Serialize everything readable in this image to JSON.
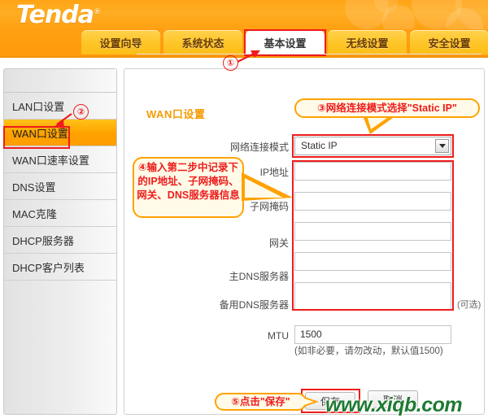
{
  "header": {
    "brand": "Tenda",
    "registered_mark": "®"
  },
  "tabs": [
    {
      "label": "设置向导",
      "active": false
    },
    {
      "label": "系统状态",
      "active": false
    },
    {
      "label": "基本设置",
      "active": true
    },
    {
      "label": "无线设置",
      "active": false
    },
    {
      "label": "安全设置",
      "active": false
    }
  ],
  "sidebar": {
    "items": [
      {
        "label": "LAN口设置",
        "active": false
      },
      {
        "label": "WAN口设置",
        "active": true
      },
      {
        "label": "WAN口速率设置",
        "active": false
      },
      {
        "label": "DNS设置",
        "active": false
      },
      {
        "label": "MAC克隆",
        "active": false
      },
      {
        "label": "DHCP服务器",
        "active": false
      },
      {
        "label": "DHCP客户列表",
        "active": false
      }
    ]
  },
  "main": {
    "title": "WAN口设置",
    "connection_mode": {
      "label": "网络连接模式",
      "value": "Static IP"
    },
    "fields": [
      {
        "label": "IP地址",
        "value": ""
      },
      {
        "label": "子网掩码",
        "value": ""
      },
      {
        "label": "网关",
        "value": ""
      },
      {
        "label": "主DNS服务器",
        "value": ""
      },
      {
        "label": "备用DNS服务器",
        "value": ""
      }
    ],
    "optional_note": "(可选)",
    "mtu": {
      "label": "MTU",
      "value": "1500",
      "hint": "(如非必要，请勿改动，默认值1500)"
    },
    "buttons": {
      "save": "保存",
      "cancel": "取消"
    }
  },
  "callouts": {
    "step1": "①",
    "step2": "②",
    "step3": "③网络连接模式选择\"Static IP\"",
    "step4": "④输入第二步中记录下的IP地址、子网掩码、网关、DNS服务器信息",
    "step5": "⑤点击\"保存\""
  },
  "watermark": "www.xiqb.com",
  "colors": {
    "brand_orange": "#ffa415",
    "tab_yellow": "#fec527",
    "highlight_red": "#ee1c1c",
    "callout_border": "#ffa200",
    "title_orange": "#f59b00",
    "watermark_green": "#1f7a33"
  }
}
